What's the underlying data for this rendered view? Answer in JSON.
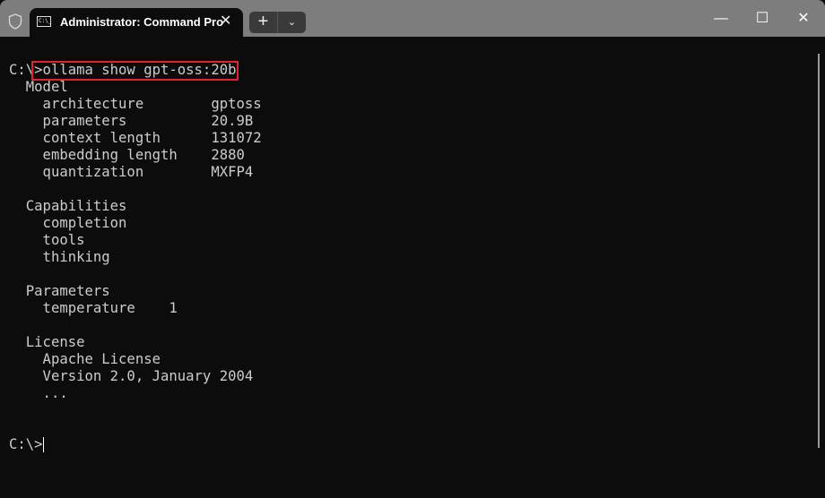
{
  "window": {
    "tab_title": "Administrator: Command Pro",
    "tab_icon_text": "C:\\_",
    "new_tab": "+",
    "dropdown": "⌄",
    "minimize": "—",
    "maximize": "☐",
    "close": "✕",
    "tab_close": "✕"
  },
  "terminal": {
    "lines": [
      "C:\\>ollama show gpt-oss:20b",
      "  Model",
      "    architecture        gptoss",
      "    parameters          20.9B",
      "    context length      131072",
      "    embedding length    2880",
      "    quantization        MXFP4",
      "",
      "  Capabilities",
      "    completion",
      "    tools",
      "    thinking",
      "",
      "  Parameters",
      "    temperature    1",
      "",
      "  License",
      "    Apache License",
      "    Version 2.0, January 2004",
      "    ...",
      "",
      "",
      "C:\\>"
    ]
  },
  "highlight_color": "#e0242a"
}
